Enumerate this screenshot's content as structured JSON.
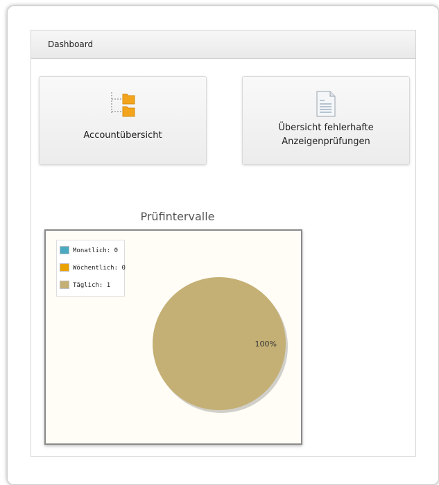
{
  "panel": {
    "title": "Dashboard"
  },
  "tiles": [
    {
      "label_line1": "Accountübersicht",
      "label_line2": "",
      "icon": "folder-tree-icon"
    },
    {
      "label_line1": "Übersicht fehlerhafte",
      "label_line2": "Anzeigenprüfungen",
      "icon": "document-list-icon"
    }
  ],
  "colors": {
    "monatlich": "#4aaac2",
    "woechentlich": "#eaa200",
    "taeglich": "#c4b075",
    "chart_bg": "#fffdf6"
  },
  "chart_data": {
    "type": "pie",
    "title": "Prüfintervalle",
    "series": [
      {
        "name": "Monatlich",
        "value": 0,
        "legend": "Monatlich: 0",
        "color": "#4aaac2"
      },
      {
        "name": "Wöchentlich",
        "value": 0,
        "legend": "Wöchentlich: 0",
        "color": "#eaa200"
      },
      {
        "name": "Täglich",
        "value": 1,
        "legend": "Täglich: 1",
        "color": "#c4b075"
      }
    ],
    "slice_labels": [
      "100%"
    ],
    "legend_position": "top-left"
  }
}
